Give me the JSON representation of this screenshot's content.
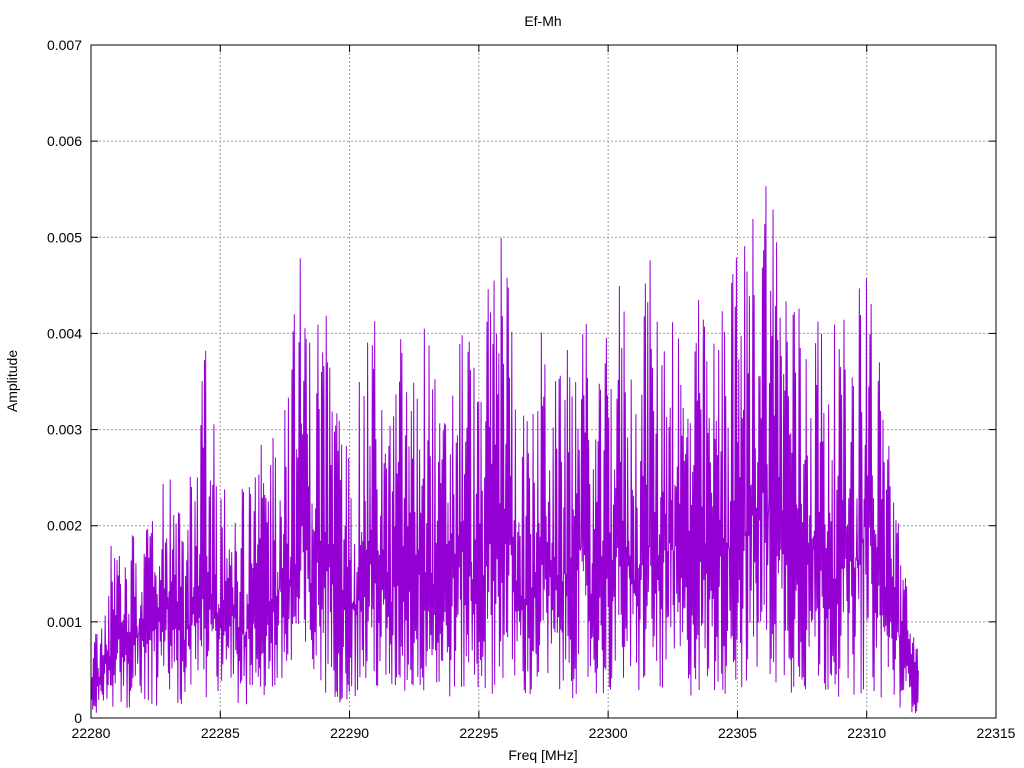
{
  "chart_data": {
    "type": "line",
    "title": "Ef-Mh",
    "xlabel": "Freq [MHz]",
    "ylabel": "Amplitude",
    "xlim": [
      22280,
      22315
    ],
    "ylim": [
      0,
      0.007
    ],
    "xticks": [
      "22280",
      "22285",
      "22290",
      "22295",
      "22300",
      "22305",
      "22310",
      "22315"
    ],
    "yticks": [
      "0",
      "0.001",
      "0.002",
      "0.003",
      "0.004",
      "0.005",
      "0.006",
      "0.007"
    ],
    "grid": true,
    "legend": "none",
    "series": [
      {
        "color": "#9400d3",
        "x": [
          22280.0,
          22280.5,
          22281.0,
          22281.5,
          22282.0,
          22282.5,
          22283.0,
          22283.5,
          22284.0,
          22284.5,
          22285.0,
          22285.5,
          22286.0,
          22286.5,
          22287.0,
          22287.5,
          22288.0,
          22288.2,
          22288.5,
          22289.0,
          22289.5,
          22290.0,
          22290.5,
          22291.0,
          22291.5,
          22292.0,
          22292.5,
          22293.0,
          22293.5,
          22294.0,
          22294.5,
          22295.0,
          22295.5,
          22296.0,
          22296.5,
          22297.0,
          22297.5,
          22298.0,
          22298.5,
          22299.0,
          22299.5,
          22300.0,
          22300.5,
          22301.0,
          22301.5,
          22302.0,
          22302.5,
          22303.0,
          22303.5,
          22304.0,
          22304.5,
          22305.0,
          22305.5,
          22306.0,
          22306.5,
          22307.0,
          22307.5,
          22308.0,
          22308.5,
          22309.0,
          22309.5,
          22310.0,
          22310.5,
          22311.0,
          22311.5,
          22312.0
        ],
        "y": [
          0.0006,
          0.0014,
          0.0022,
          0.0018,
          0.0027,
          0.0024,
          0.0031,
          0.0021,
          0.0028,
          0.0041,
          0.0024,
          0.0027,
          0.0023,
          0.0028,
          0.0031,
          0.0037,
          0.0046,
          0.0052,
          0.0039,
          0.0047,
          0.0033,
          0.0029,
          0.0037,
          0.0043,
          0.003,
          0.0041,
          0.0036,
          0.0044,
          0.0031,
          0.0038,
          0.0045,
          0.0034,
          0.0049,
          0.0054,
          0.0036,
          0.003,
          0.0043,
          0.0035,
          0.0039,
          0.0046,
          0.0032,
          0.0041,
          0.0047,
          0.0036,
          0.005,
          0.0041,
          0.0048,
          0.0037,
          0.0044,
          0.0039,
          0.0046,
          0.0049,
          0.0052,
          0.0063,
          0.0055,
          0.0048,
          0.0043,
          0.0045,
          0.004,
          0.0042,
          0.0041,
          0.0053,
          0.0038,
          0.003,
          0.0015,
          0.0008
        ]
      }
    ]
  }
}
